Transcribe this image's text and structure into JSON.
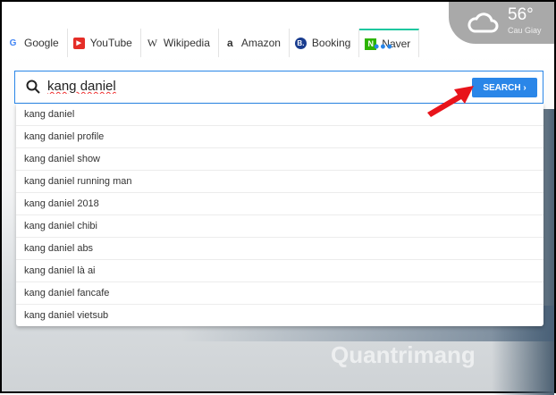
{
  "weather": {
    "temp": "56°",
    "location": "Cau Giay",
    "icon": "cloud-icon"
  },
  "tabs": [
    {
      "label": "Google",
      "icon": "google-icon"
    },
    {
      "label": "YouTube",
      "icon": "youtube-icon"
    },
    {
      "label": "Wikipedia",
      "icon": "wikipedia-icon"
    },
    {
      "label": "Amazon",
      "icon": "amazon-icon"
    },
    {
      "label": "Booking",
      "icon": "booking-icon"
    },
    {
      "label": "Naver",
      "icon": "naver-icon"
    }
  ],
  "more": "•••",
  "search": {
    "value": "kang daniel",
    "button": "SEARCH ›",
    "accent": "#2a86e8"
  },
  "suggestions": [
    "kang daniel",
    "kang daniel profile",
    "kang daniel show",
    "kang daniel running man",
    "kang daniel 2018",
    "kang daniel chibi",
    "kang daniel abs",
    "kang daniel là ai",
    "kang daniel fancafe",
    "kang daniel vietsub"
  ],
  "watermark": "Quantrimang"
}
